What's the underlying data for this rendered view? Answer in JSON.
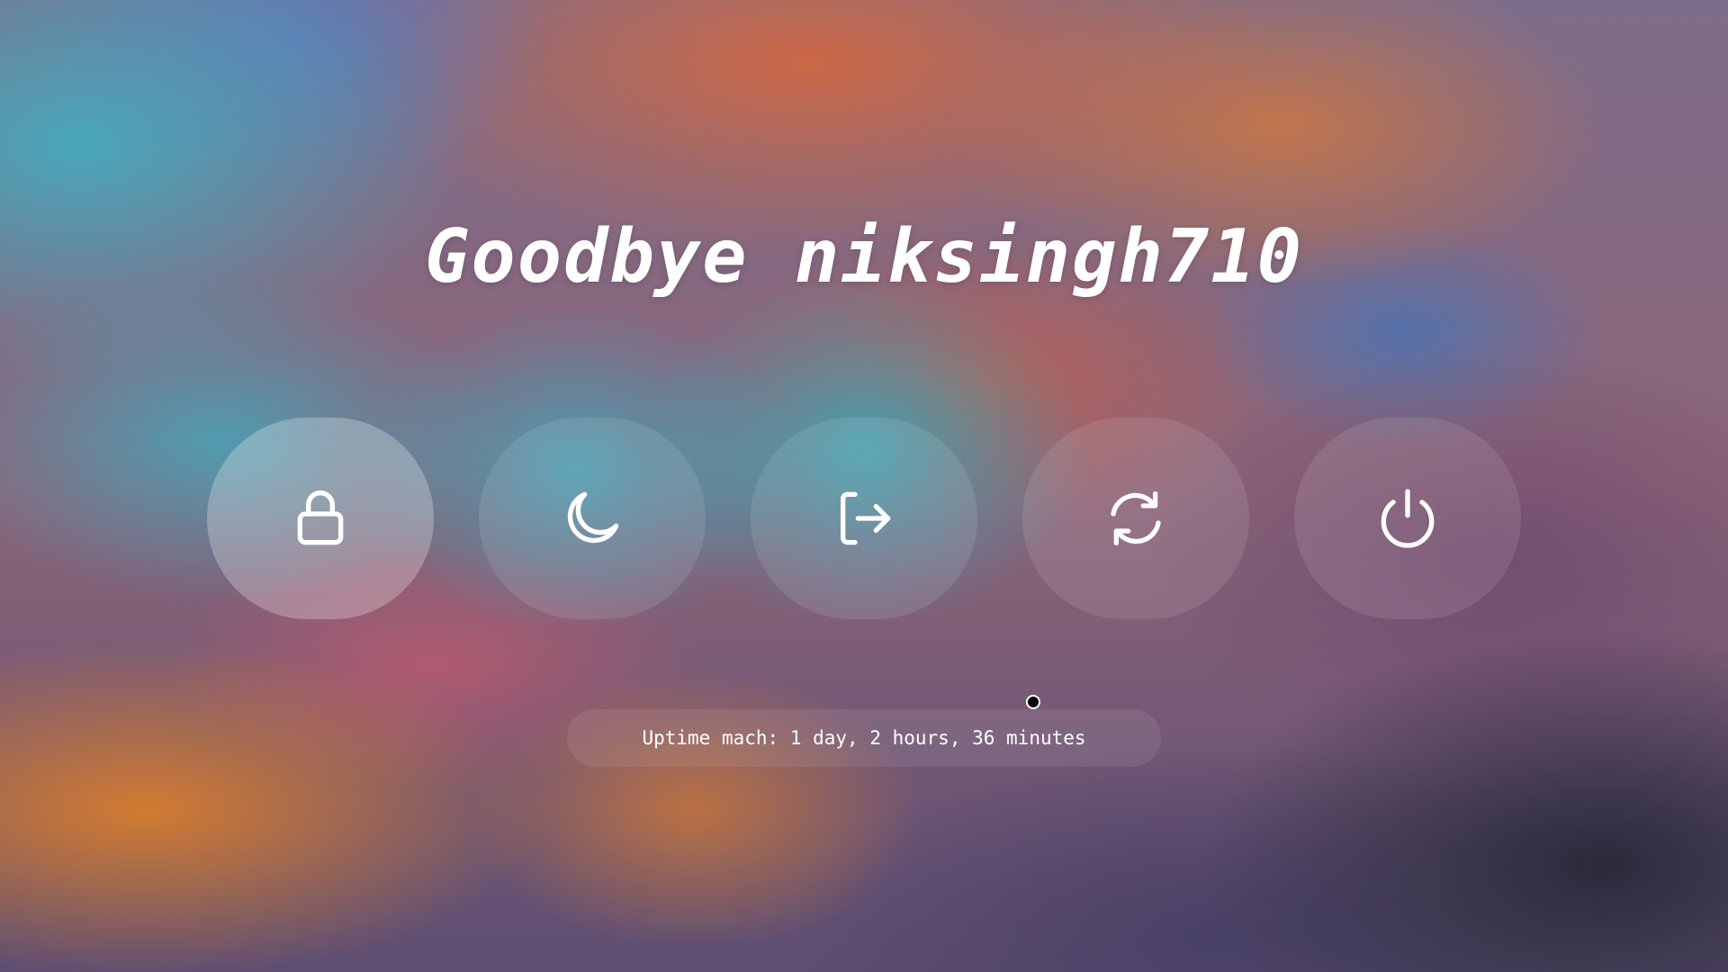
{
  "greeting": {
    "text": "Goodbye niksingh710"
  },
  "actions": [
    {
      "id": "lock",
      "icon": "lock-icon",
      "selected": true
    },
    {
      "id": "suspend",
      "icon": "moon-icon",
      "selected": false
    },
    {
      "id": "logout",
      "icon": "logout-icon",
      "selected": false
    },
    {
      "id": "reboot",
      "icon": "refresh-icon",
      "selected": false
    },
    {
      "id": "shutdown",
      "icon": "power-icon",
      "selected": false
    }
  ],
  "uptime": {
    "text": "Uptime mach: 1 day, 2 hours, 36 minutes"
  },
  "colors": {
    "text": "#ffffff",
    "button_bg": "rgba(255,255,255,0.10)",
    "button_selected_bg": "rgba(255,255,255,0.26)"
  }
}
